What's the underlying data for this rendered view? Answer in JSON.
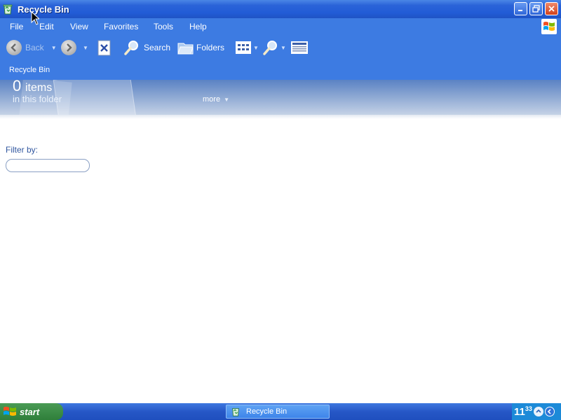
{
  "window": {
    "title": "Recycle Bin",
    "icon": "recycle-bin-icon"
  },
  "menu": {
    "items": [
      "File",
      "Edit",
      "View",
      "Favorites",
      "Tools",
      "Help"
    ]
  },
  "toolbar": {
    "back_label": "Back",
    "search_label": "Search",
    "folders_label": "Folders"
  },
  "address": {
    "text": "Recycle Bin"
  },
  "banner": {
    "count": "0",
    "count_unit": "items",
    "subtitle": "in this folder",
    "more_label": "more"
  },
  "filter": {
    "label": "Filter by:",
    "value": "",
    "placeholder": ""
  },
  "taskbar": {
    "start_label": "start",
    "task_label": "Recycle Bin",
    "clock_hour": "11",
    "clock_minutes": "33"
  },
  "colors": {
    "title_bar": "#225cd6",
    "chrome": "#3d7be2",
    "taskbar": "#2657c6",
    "start_green": "#3a8a45",
    "filter_label": "#31579f"
  }
}
